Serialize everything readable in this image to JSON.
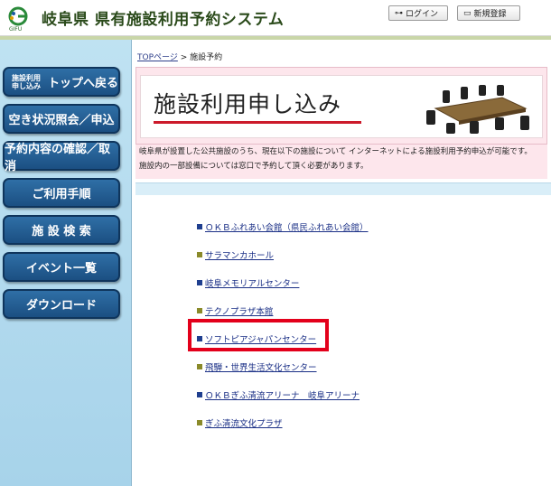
{
  "header": {
    "logo_text": "GIFU",
    "title": "岐阜県 県有施設利用予約システム",
    "login_label": "ログイン",
    "register_label": "新規登録"
  },
  "sidebar": {
    "items": [
      {
        "small": "施設利用\n申し込み",
        "label": "トップへ戻る"
      },
      {
        "label": "空き状況照会／申込"
      },
      {
        "label": "予約内容の確認／取消"
      },
      {
        "label": "ご利用手順"
      },
      {
        "label": "施 設 検 索"
      },
      {
        "label": "イベント一覧"
      },
      {
        "label": "ダウンロード"
      }
    ]
  },
  "breadcrumb": {
    "top": "TOPページ",
    "separator": " > ",
    "current": "施設予約"
  },
  "banner": {
    "title": "施設利用申し込み"
  },
  "description": {
    "line1": "岐阜県が設置した公共施設のうち、現在以下の施設について インターネットによる施設利用予約申込が可能です。",
    "line2": "施設内の一部設備については窓口で予約して頂く必要があります。"
  },
  "facilities": [
    {
      "name": "ＯＫＢふれあい会館（県民ふれあい会館）",
      "color": "#1f3f8f"
    },
    {
      "name": "サラマンカホール",
      "color": "#8a8a2a"
    },
    {
      "name": "岐阜メモリアルセンター",
      "color": "#1f3f8f"
    },
    {
      "name": "テクノプラザ本館",
      "color": "#8a8a2a"
    },
    {
      "name": "ソフトピアジャパンセンター",
      "color": "#1f3f8f"
    },
    {
      "name": "飛騨・世界生活文化センター",
      "color": "#8a8a2a"
    },
    {
      "name": "ＯＫＢぎふ清流アリーナ　岐阜アリーナ",
      "color": "#1f3f8f"
    },
    {
      "name": "ぎふ清流文化プラザ",
      "color": "#8a8a2a"
    }
  ],
  "colors": {
    "highlight": "#e3001b",
    "nav_button": "#1b4f82",
    "link": "#1a2f86"
  }
}
